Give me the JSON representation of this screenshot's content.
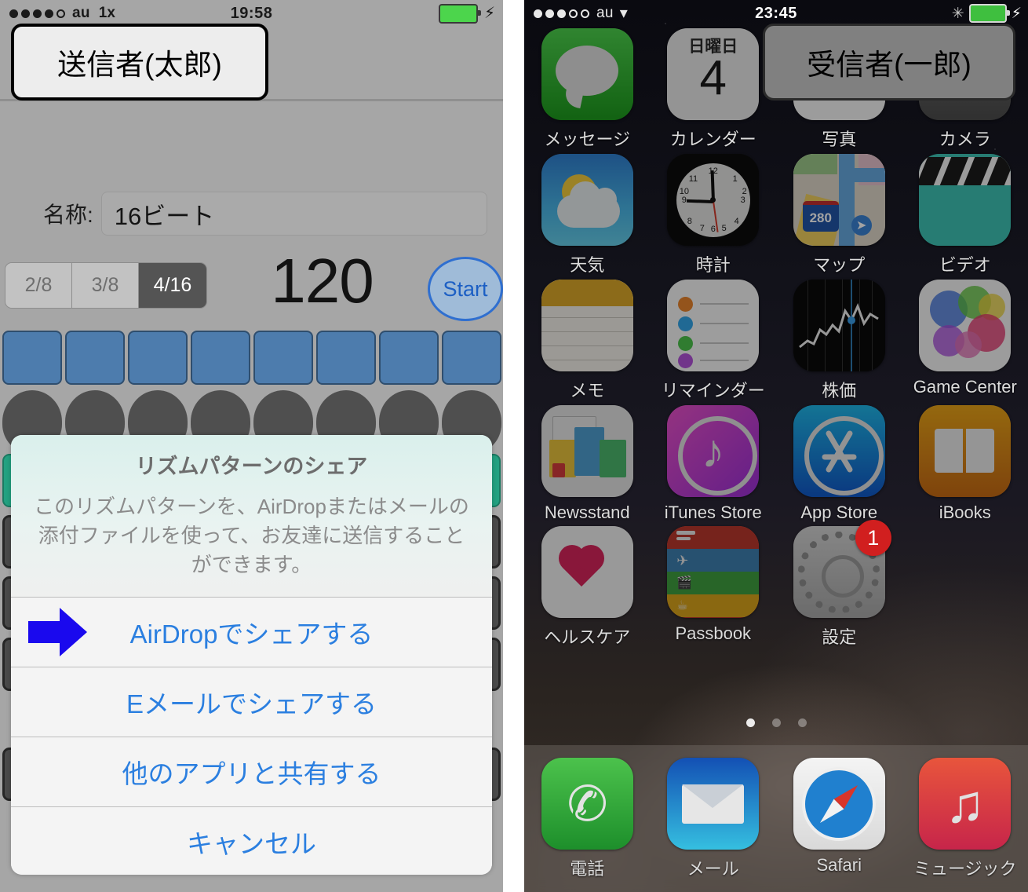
{
  "left_phone": {
    "callout": "送信者(太郎)",
    "status_bar": {
      "carrier": "au",
      "network": "1x",
      "time": "19:58",
      "signal_dots": 5,
      "signal_filled": 4
    },
    "app": {
      "name_label": "名称:",
      "name_value": "16ビート",
      "segments": [
        "2/8",
        "3/8",
        "4/16"
      ],
      "selected_segment": "4/16",
      "bpm": "120",
      "start_button": "Start",
      "pad_count": 8,
      "knob_count": 8
    },
    "action_sheet": {
      "title": "リズムパターンのシェア",
      "message": "このリズムパターンを、AirDropまたはメールの添付ファイルを使って、お友達に送信することができます。",
      "options": [
        {
          "label": "AirDropでシェアする",
          "has_arrow": true
        },
        {
          "label": "Eメールでシェアする",
          "has_arrow": false
        },
        {
          "label": "他のアプリと共有する",
          "has_arrow": false
        }
      ],
      "cancel_label": "キャンセル",
      "tint_color": "#2b7fe0",
      "arrow_color": "#1a09ee"
    }
  },
  "right_phone": {
    "callout": "受信者(一郎)",
    "status_bar": {
      "carrier": "au",
      "time": "23:45",
      "signal_dots": 5,
      "signal_filled": 3,
      "wifi": true,
      "bluetooth": true
    },
    "home_screen": {
      "rows": [
        [
          {
            "label": "メッセージ",
            "icon": "messages-icon"
          },
          {
            "label": "カレンダー",
            "icon": "calendar-icon",
            "day": "日曜日",
            "date": "4"
          },
          {
            "label": "写真",
            "icon": "photos-icon"
          },
          {
            "label": "カメラ",
            "icon": "camera-icon"
          }
        ],
        [
          {
            "label": "天気",
            "icon": "weather-icon"
          },
          {
            "label": "時計",
            "icon": "clock-icon"
          },
          {
            "label": "マップ",
            "icon": "maps-icon",
            "route": "280"
          },
          {
            "label": "ビデオ",
            "icon": "videos-icon"
          }
        ],
        [
          {
            "label": "メモ",
            "icon": "notes-icon"
          },
          {
            "label": "リマインダー",
            "icon": "reminders-icon"
          },
          {
            "label": "株価",
            "icon": "stocks-icon"
          },
          {
            "label": "Game Center",
            "icon": "game-center-icon"
          }
        ],
        [
          {
            "label": "Newsstand",
            "icon": "newsstand-icon"
          },
          {
            "label": "iTunes Store",
            "icon": "itunes-store-icon"
          },
          {
            "label": "App Store",
            "icon": "app-store-icon"
          },
          {
            "label": "iBooks",
            "icon": "ibooks-icon"
          }
        ],
        [
          {
            "label": "ヘルスケア",
            "icon": "health-icon"
          },
          {
            "label": "Passbook",
            "icon": "passbook-icon"
          },
          {
            "label": "設定",
            "icon": "settings-icon",
            "badge": "1"
          }
        ]
      ],
      "page_dots": {
        "count": 3,
        "active_index": 0
      },
      "dock": [
        {
          "label": "電話",
          "icon": "phone-icon"
        },
        {
          "label": "メール",
          "icon": "mail-icon"
        },
        {
          "label": "Safari",
          "icon": "safari-icon"
        },
        {
          "label": "ミュージック",
          "icon": "music-icon"
        }
      ]
    }
  }
}
